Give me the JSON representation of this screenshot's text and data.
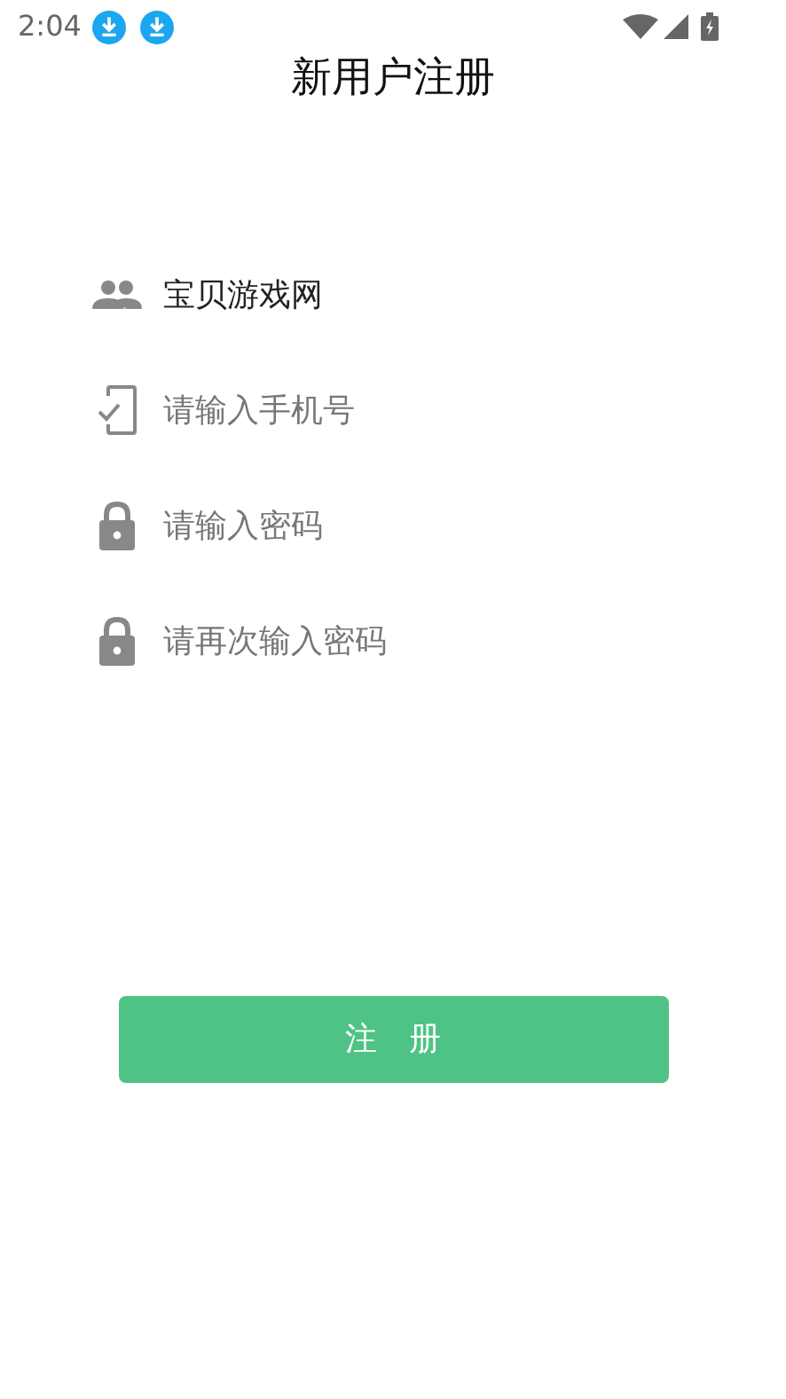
{
  "status_bar": {
    "time": "2:04",
    "notifications": [
      {
        "kind": "download"
      },
      {
        "kind": "download"
      }
    ]
  },
  "title": "新用户注册",
  "fields": [
    {
      "kind": "user",
      "value": "宝贝游戏网"
    },
    {
      "kind": "phone",
      "placeholder": "请输入手机号"
    },
    {
      "kind": "lock",
      "placeholder": "请输入密码"
    },
    {
      "kind": "lock",
      "placeholder": "请再次输入密码"
    }
  ],
  "submit_button": "注　册"
}
